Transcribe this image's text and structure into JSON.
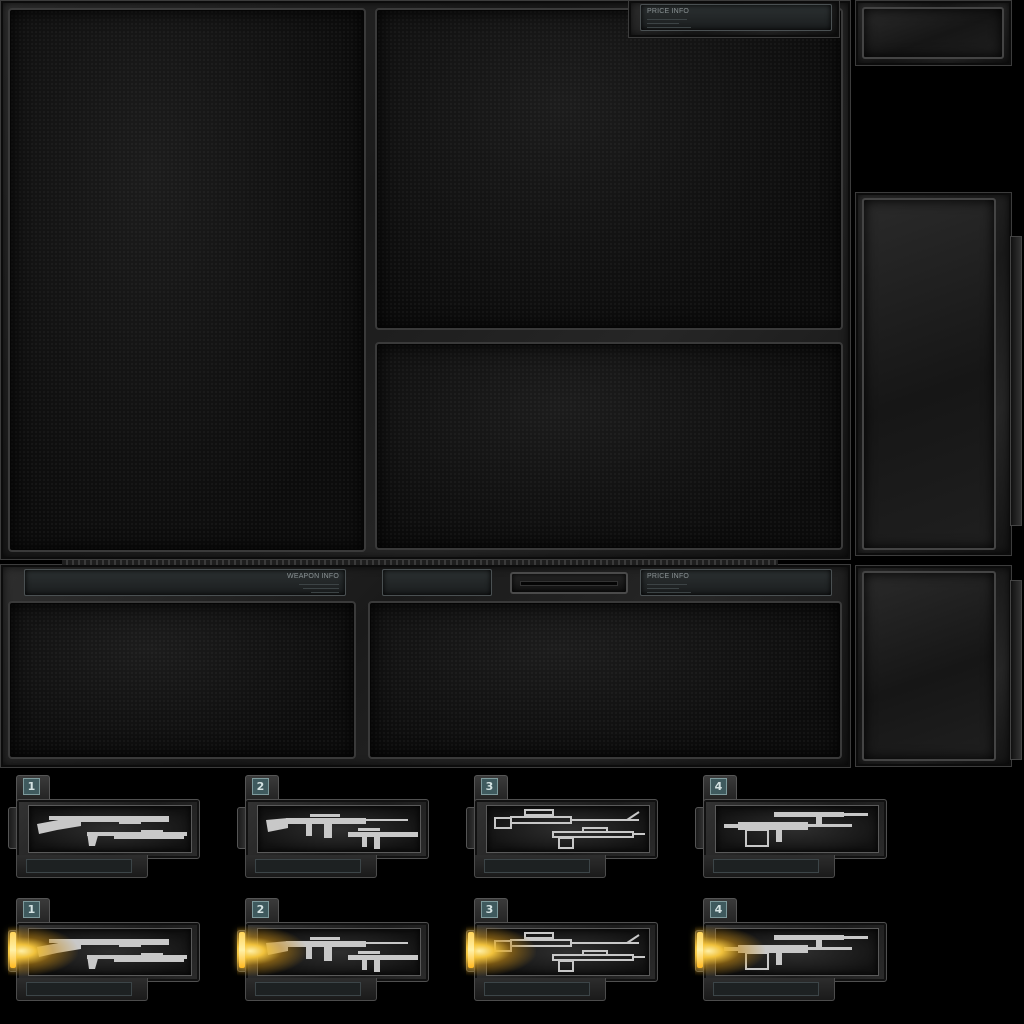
{
  "labels": {
    "price_info_top": "PRICE INFO",
    "weapon_info": "WEAPON INFO",
    "price_info_bottom": "PRICE INFO"
  },
  "weapon_cards": [
    {
      "slot": "1",
      "state": "normal",
      "icon": "shotgun-icon"
    },
    {
      "slot": "2",
      "state": "normal",
      "icon": "assault-rifle-icon"
    },
    {
      "slot": "3",
      "state": "normal",
      "icon": "sniper-rifle-icon"
    },
    {
      "slot": "4",
      "state": "normal",
      "icon": "machine-gun-icon"
    },
    {
      "slot": "1",
      "state": "highlighted",
      "icon": "shotgun-icon"
    },
    {
      "slot": "2",
      "state": "highlighted",
      "icon": "assault-rifle-icon"
    },
    {
      "slot": "3",
      "state": "highlighted",
      "icon": "sniper-rifle-icon"
    },
    {
      "slot": "4",
      "state": "highlighted",
      "icon": "machine-gun-icon"
    }
  ],
  "colors": {
    "frame": "#262626",
    "panel": "#0f0f0f",
    "badge": "#3f5a5e",
    "highlight_glow": "#f1c23c"
  }
}
